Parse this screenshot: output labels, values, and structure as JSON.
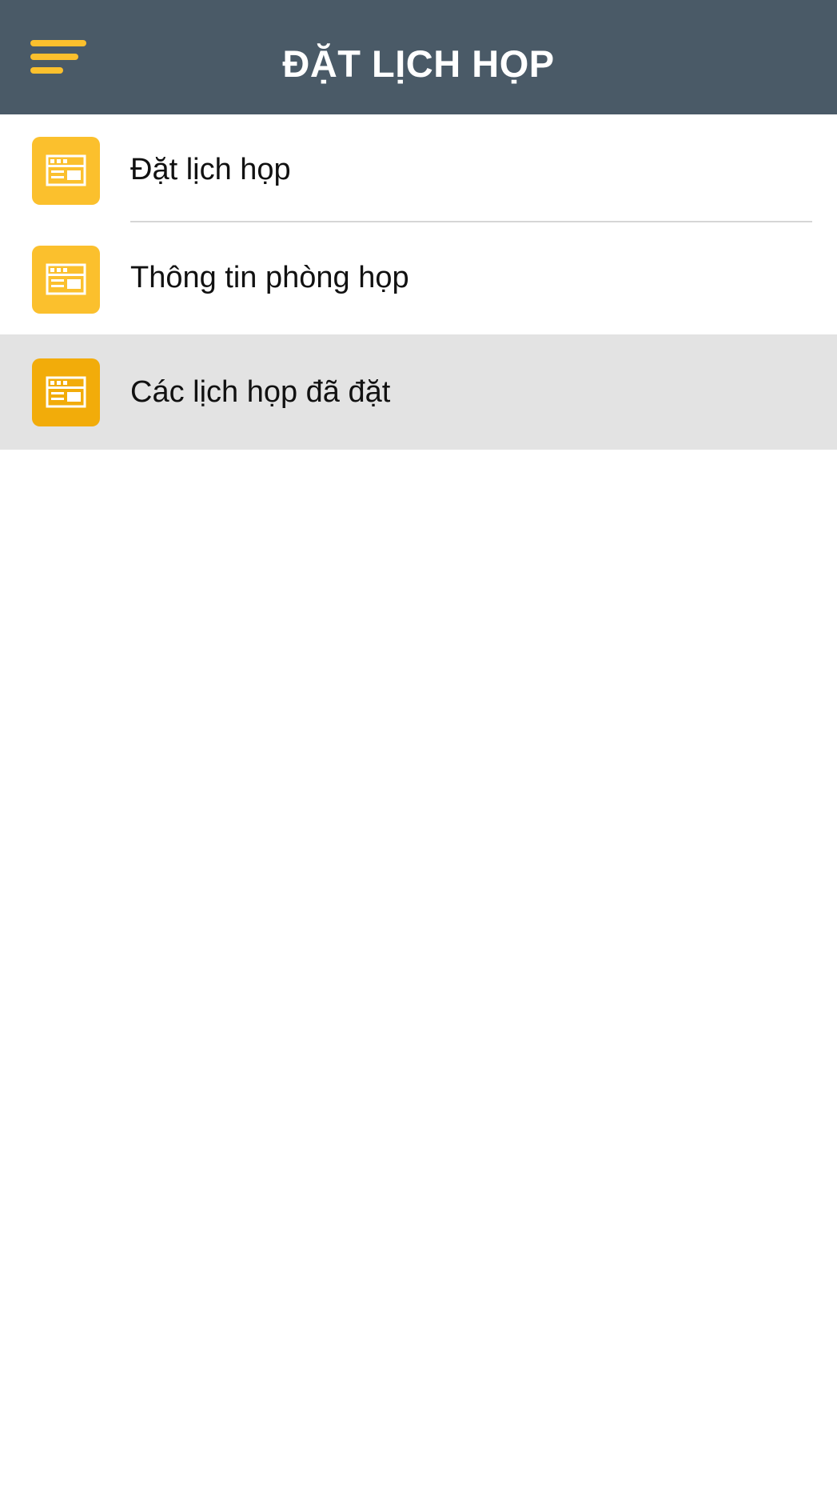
{
  "header": {
    "title": "ĐẶT LỊCH HỌP",
    "background_color": "#4a5a67",
    "menu_icon": "hamburger-menu-icon",
    "accent_color": "#fbc02d"
  },
  "menu": {
    "items": [
      {
        "label": "Đặt lịch họp",
        "icon": "calendar-window-icon",
        "selected": false
      },
      {
        "label": "Thông tin phòng họp",
        "icon": "calendar-window-icon",
        "selected": false
      },
      {
        "label": "Các lịch họp đã đặt",
        "icon": "calendar-window-icon",
        "selected": true
      }
    ],
    "selected_background": "#e3e3e3"
  }
}
